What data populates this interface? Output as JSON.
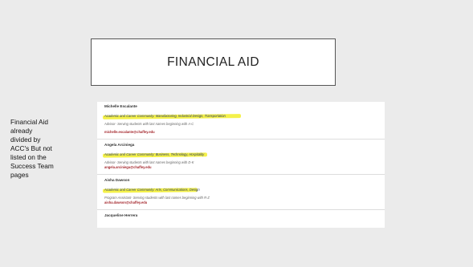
{
  "slide": {
    "title": "FINANCIAL AID",
    "note_lines": [
      "Financial Aid",
      "already",
      "divided by",
      "ACC's But not",
      "listed on the",
      "Success Team",
      "pages"
    ]
  },
  "entries": [
    {
      "name": "Michelle Escalante",
      "area": "Academic and Career Community: Manufacturing, Industrial Design, Transportation",
      "role": "Advisor- Serving students with last names beginning with A-C",
      "email": "michelle.escalante@chaffey.edu"
    },
    {
      "name": "Angela Arciniega",
      "area": "Academic and Career Community: Business, Technology, Hospitality",
      "role": "Advisor- Serving students with last names beginning with D-K",
      "email": "angela.arciniega@chaffey.edu"
    },
    {
      "name": "Aisha Dawson",
      "area": "Academic and Career Community: Arts, Communications, Design",
      "role": "Program Assistant- Serving students with last names beginning with R-Z",
      "email": "aisha.dawson@chaffey.edu"
    },
    {
      "name": "Jacqueline Herrera"
    }
  ],
  "colors": {
    "highlight": "#f2ef2a",
    "email_link": "#a4262c",
    "background": "#ebebeb"
  }
}
